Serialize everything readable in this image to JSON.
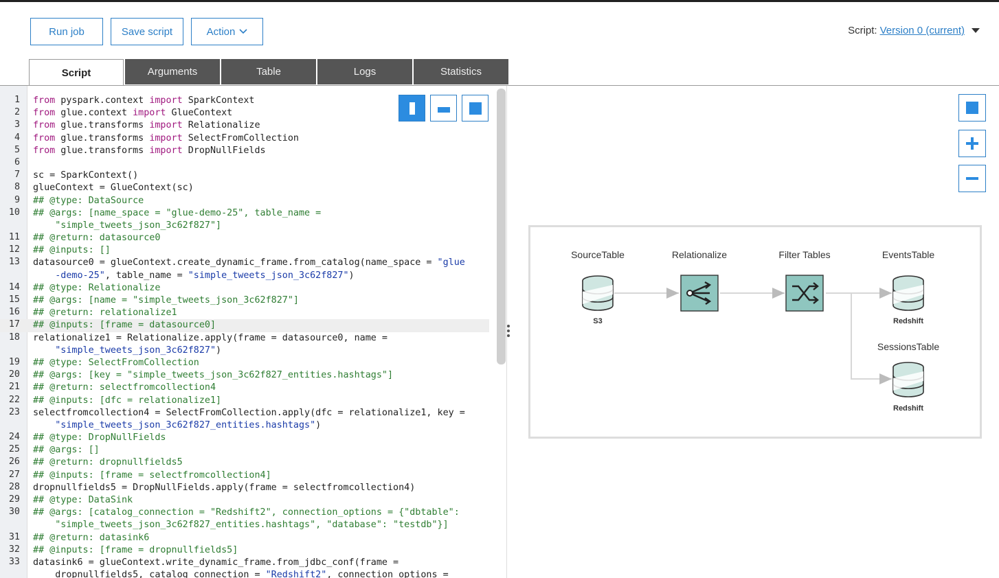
{
  "toolbar": {
    "run_job": "Run job",
    "save_script": "Save script",
    "action": "Action"
  },
  "script_version": {
    "label": "Script:",
    "value": "Version 0 (current)"
  },
  "tabs": [
    {
      "label": "Script",
      "active": true
    },
    {
      "label": "Arguments",
      "active": false
    },
    {
      "label": "Table",
      "active": false
    },
    {
      "label": "Logs",
      "active": false
    },
    {
      "label": "Statistics",
      "active": false
    }
  ],
  "code_lines": [
    {
      "n": "1",
      "segs": [
        [
          [
            "k",
            "from"
          ],
          [
            "t",
            " pyspark.context "
          ],
          [
            "k",
            "import"
          ],
          [
            "t",
            " SparkContext"
          ]
        ]
      ]
    },
    {
      "n": "2",
      "segs": [
        [
          [
            "k",
            "from"
          ],
          [
            "t",
            " glue.context "
          ],
          [
            "k",
            "import"
          ],
          [
            "t",
            " GlueContext"
          ]
        ]
      ]
    },
    {
      "n": "3",
      "segs": [
        [
          [
            "k",
            "from"
          ],
          [
            "t",
            " glue.transforms "
          ],
          [
            "k",
            "import"
          ],
          [
            "t",
            " Relationalize"
          ]
        ]
      ]
    },
    {
      "n": "4",
      "segs": [
        [
          [
            "k",
            "from"
          ],
          [
            "t",
            " glue.transforms "
          ],
          [
            "k",
            "import"
          ],
          [
            "t",
            " SelectFromCollection"
          ]
        ]
      ]
    },
    {
      "n": "5",
      "segs": [
        [
          [
            "k",
            "from"
          ],
          [
            "t",
            " glue.transforms "
          ],
          [
            "k",
            "import"
          ],
          [
            "t",
            " DropNullFields"
          ]
        ]
      ]
    },
    {
      "n": "6",
      "segs": [
        [
          [
            "t",
            ""
          ]
        ]
      ]
    },
    {
      "n": "7",
      "segs": [
        [
          [
            "t",
            "sc = SparkContext()"
          ]
        ]
      ]
    },
    {
      "n": "8",
      "segs": [
        [
          [
            "t",
            "glueContext = GlueContext(sc)"
          ]
        ]
      ]
    },
    {
      "n": "9",
      "segs": [
        [
          [
            "c",
            "## @type: DataSource"
          ]
        ]
      ]
    },
    {
      "n": "10",
      "segs": [
        [
          [
            "c",
            "## @args: [name_space = \"glue-demo-25\", table_name ="
          ]
        ],
        [
          [
            "c",
            "    \"simple_tweets_json_3c62f827\"]"
          ]
        ]
      ]
    },
    {
      "n": "11",
      "segs": [
        [
          [
            "c",
            "## @return: datasource0"
          ]
        ]
      ]
    },
    {
      "n": "12",
      "segs": [
        [
          [
            "c",
            "## @inputs: []"
          ]
        ]
      ]
    },
    {
      "n": "13",
      "segs": [
        [
          [
            "t",
            "datasource0 = glueContext.create_dynamic_frame.from_catalog(name_space = "
          ],
          [
            "s",
            "\"glue"
          ]
        ],
        [
          [
            "s",
            "    -demo-25\""
          ],
          [
            "t",
            ", table_name = "
          ],
          [
            "s",
            "\"simple_tweets_json_3c62f827\""
          ],
          [
            "t",
            ")"
          ]
        ]
      ]
    },
    {
      "n": "14",
      "segs": [
        [
          [
            "c",
            "## @type: Relationalize"
          ]
        ]
      ]
    },
    {
      "n": "15",
      "segs": [
        [
          [
            "c",
            "## @args: [name = \"simple_tweets_json_3c62f827\"]"
          ]
        ]
      ]
    },
    {
      "n": "16",
      "segs": [
        [
          [
            "c",
            "## @return: relationalize1"
          ]
        ]
      ]
    },
    {
      "n": "17",
      "hl": true,
      "segs": [
        [
          [
            "c",
            "## @inputs: [frame = datasource0]"
          ]
        ]
      ]
    },
    {
      "n": "18",
      "segs": [
        [
          [
            "t",
            "relationalize1 = Relationalize.apply(frame = datasource0, name ="
          ]
        ],
        [
          [
            "s",
            "    \"simple_tweets_json_3c62f827\""
          ],
          [
            "t",
            ")"
          ]
        ]
      ]
    },
    {
      "n": "19",
      "segs": [
        [
          [
            "c",
            "## @type: SelectFromCollection"
          ]
        ]
      ]
    },
    {
      "n": "20",
      "segs": [
        [
          [
            "c",
            "## @args: [key = \"simple_tweets_json_3c62f827_entities.hashtags\"]"
          ]
        ]
      ]
    },
    {
      "n": "21",
      "segs": [
        [
          [
            "c",
            "## @return: selectfromcollection4"
          ]
        ]
      ]
    },
    {
      "n": "22",
      "segs": [
        [
          [
            "c",
            "## @inputs: [dfc = relationalize1]"
          ]
        ]
      ]
    },
    {
      "n": "23",
      "segs": [
        [
          [
            "t",
            "selectfromcollection4 = SelectFromCollection.apply(dfc = relationalize1, key ="
          ]
        ],
        [
          [
            "s",
            "    \"simple_tweets_json_3c62f827_entities.hashtags\""
          ],
          [
            "t",
            ")"
          ]
        ]
      ]
    },
    {
      "n": "24",
      "segs": [
        [
          [
            "c",
            "## @type: DropNullFields"
          ]
        ]
      ]
    },
    {
      "n": "25",
      "segs": [
        [
          [
            "c",
            "## @args: []"
          ]
        ]
      ]
    },
    {
      "n": "26",
      "segs": [
        [
          [
            "c",
            "## @return: dropnullfields5"
          ]
        ]
      ]
    },
    {
      "n": "27",
      "segs": [
        [
          [
            "c",
            "## @inputs: [frame = selectfromcollection4]"
          ]
        ]
      ]
    },
    {
      "n": "28",
      "segs": [
        [
          [
            "t",
            "dropnullfields5 = DropNullFields.apply(frame = selectfromcollection4)"
          ]
        ]
      ]
    },
    {
      "n": "29",
      "segs": [
        [
          [
            "c",
            "## @type: DataSink"
          ]
        ]
      ]
    },
    {
      "n": "30",
      "segs": [
        [
          [
            "c",
            "## @args: [catalog_connection = \"Redshift2\", connection_options = {\"dbtable\":"
          ]
        ],
        [
          [
            "c",
            "    \"simple_tweets_json_3c62f827_entities.hashtags\", \"database\": \"testdb\"}]"
          ]
        ]
      ]
    },
    {
      "n": "31",
      "segs": [
        [
          [
            "c",
            "## @return: datasink6"
          ]
        ]
      ]
    },
    {
      "n": "32",
      "segs": [
        [
          [
            "c",
            "## @inputs: [frame = dropnullfields5]"
          ]
        ]
      ]
    },
    {
      "n": "33",
      "segs": [
        [
          [
            "t",
            "datasink6 = glueContext.write_dynamic_frame.from_jdbc_conf(frame ="
          ]
        ],
        [
          [
            "t",
            "    dropnullfields5, catalog_connection = "
          ],
          [
            "s",
            "\"Redshift2\""
          ],
          [
            "t",
            ", connection_options ="
          ]
        ]
      ]
    }
  ],
  "diagram": {
    "nodes": {
      "source": {
        "title": "SourceTable",
        "sub": "S3",
        "icon": "database-icon"
      },
      "relationalize": {
        "title": "Relationalize",
        "icon": "relationalize-icon"
      },
      "filter": {
        "title": "Filter Tables",
        "icon": "shuffle-icon"
      },
      "events": {
        "title": "EventsTable",
        "sub": "Redshift",
        "icon": "database-icon"
      },
      "sessions": {
        "title": "SessionsTable",
        "sub": "Redshift",
        "icon": "database-icon"
      }
    }
  },
  "colors": {
    "accent": "#2c7fc7",
    "tab_inactive": "#555555",
    "transform_node": "#8fc6bf",
    "comment": "#2e7d32",
    "keyword": "#a0197f",
    "string": "#1a3ba8"
  }
}
